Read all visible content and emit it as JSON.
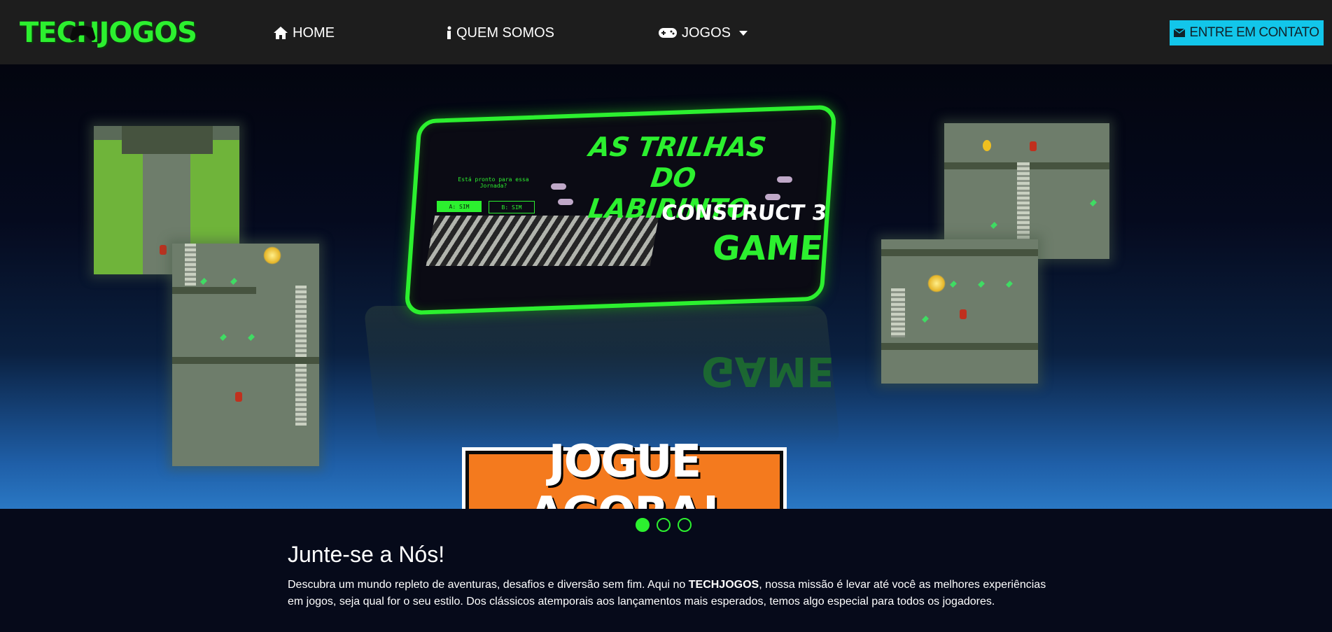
{
  "brand": {
    "logo_text": "TECHJOGOS",
    "accent": "#2cf02f"
  },
  "nav": {
    "home": {
      "label": "HOME",
      "icon": "home-icon"
    },
    "about": {
      "label": "QUEM SOMOS",
      "icon": "info-icon"
    },
    "games": {
      "label": "JOGOS",
      "icon": "gamepad-icon"
    },
    "contact": {
      "label": "ENTRE EM CONTATO",
      "icon": "envelope-icon",
      "color": "#12c6ea"
    }
  },
  "hero": {
    "game_title": "AS TRILHAS DO LABIRINTO",
    "engine": "CONSTRUCT 3",
    "game_word": "GAME",
    "question": "Está pronto para essa Jornada?",
    "option_a": "A: SIM",
    "option_b": "B: SIM",
    "cta_label": "JOGUE AGORA!",
    "cta_color": "#f47a1e"
  },
  "carousel": {
    "slides": 3,
    "active": 1
  },
  "intro": {
    "title": "Junte-se a Nós!",
    "text_before": "Descubra um mundo repleto de aventuras, desafios e diversão sem fim. Aqui no ",
    "text_bold": "TECHJOGOS",
    "text_after": ", nossa missão é levar até você as melhores experiências em jogos, seja qual for o seu estilo. Dos clássicos atemporais aos lançamentos mais esperados, temos algo especial para todos os jogadores."
  }
}
